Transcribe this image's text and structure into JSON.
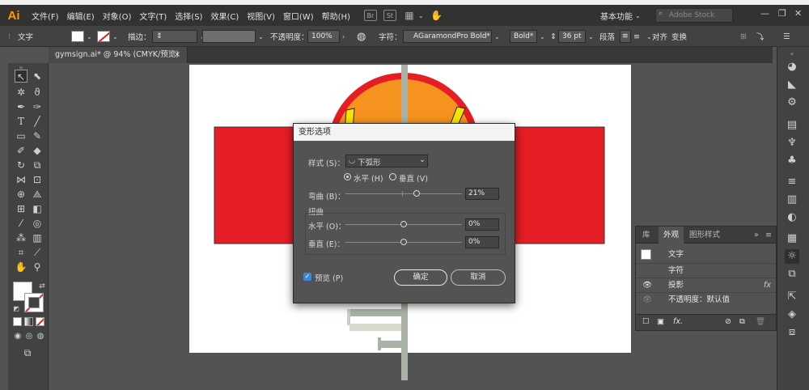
{
  "menubar": {
    "logo": "Ai",
    "items": [
      "文件(F)",
      "编辑(E)",
      "对象(O)",
      "文字(T)",
      "选择(S)",
      "效果(C)",
      "视图(V)",
      "窗口(W)",
      "帮助(H)"
    ],
    "icon_br": "Br",
    "icon_st": "St",
    "workspace": "基本功能",
    "search_placeholder": "Adobe Stock"
  },
  "controlbar": {
    "type_label": "文字",
    "stroke_label": "描边：",
    "opacity_label": "不透明度：",
    "opacity_value": "100%",
    "char_label": "字符：",
    "font_name": "AGaramondPro Bold*",
    "font_style": "Bold*",
    "font_size": "36 pt",
    "paragraph_label": "段落",
    "align_label": "对齐",
    "transform_label": "变换"
  },
  "document": {
    "tab_title": "gymsign.ai* @ 94% (CMYK/预览)",
    "close_glyph": "×"
  },
  "dialog": {
    "title": "变形选项",
    "style_label": "样式 (S)：",
    "style_value": "下弧形",
    "orientation_horizontal": "水平 (H)",
    "orientation_vertical": "垂直 (V)",
    "orientation_selected": "horizontal",
    "bend_label": "弯曲 (B)：",
    "bend_value": "21%",
    "distortion_header": "扭曲",
    "horizontal_label": "水平 (O)：",
    "horizontal_value": "0%",
    "vertical_label": "垂直 (E)：",
    "vertical_value": "0%",
    "preview_label": "预览 (P)",
    "preview_checked": true,
    "ok_label": "确定",
    "cancel_label": "取消",
    "bend_level": 0.61,
    "h_level": 0.5,
    "v_level": 0.5
  },
  "appearance_panel": {
    "tabs": [
      "库",
      "外观",
      "图形样式"
    ],
    "active_tab": "外观",
    "title_text": "文字",
    "rows": [
      "字符",
      "投影",
      "不透明度：默认值"
    ],
    "fx_glyph": "fx"
  },
  "colors": {
    "accent": "#1d72d8",
    "logo": "#ff9a00",
    "sign_red": "#e51d24",
    "sign_orange": "#f6921e",
    "sign_yellow": "#f6e500",
    "pole": "#a9b2a4"
  }
}
